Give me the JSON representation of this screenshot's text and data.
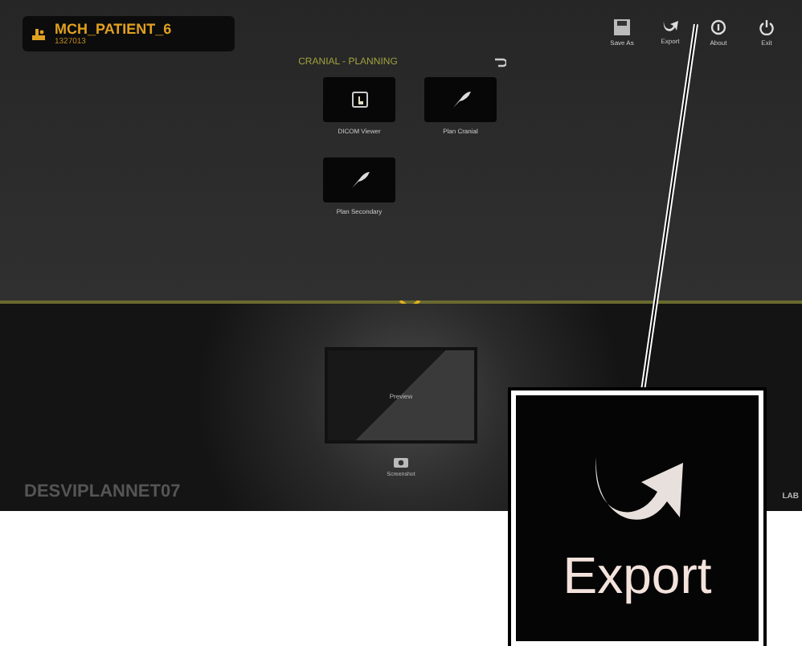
{
  "patient": {
    "name": "MCH_PATIENT_6",
    "id": "1327013"
  },
  "toolbar": [
    {
      "kind": "save",
      "label": "Save As"
    },
    {
      "kind": "export",
      "label": "Export"
    },
    {
      "kind": "about",
      "label": "About"
    },
    {
      "kind": "exit",
      "label": "Exit"
    }
  ],
  "section": {
    "title": "CRANIAL - PLANNING"
  },
  "tiles": [
    {
      "kind": "viewer",
      "label": "DICOM Viewer"
    },
    {
      "kind": "plan",
      "label": "Plan Cranial"
    },
    {
      "kind": "plan",
      "label": "Plan Secondary"
    }
  ],
  "preview": {
    "label": "Preview"
  },
  "screenshot": {
    "label": "Screenshot"
  },
  "station": "DESVIPLANNET07",
  "corner": "LAB",
  "callout": {
    "label": "Export"
  }
}
